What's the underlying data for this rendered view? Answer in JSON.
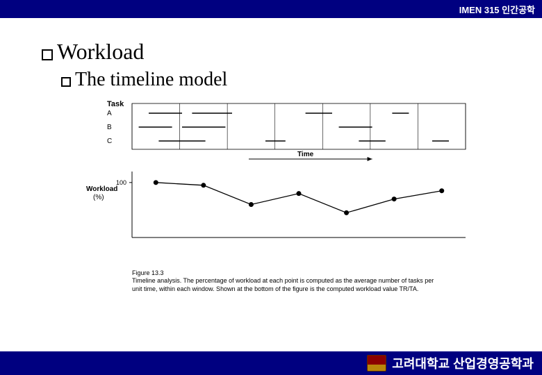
{
  "header": {
    "course": "IMEN 315 인간공학"
  },
  "headings": {
    "h1": "Workload",
    "h2": "The timeline model"
  },
  "figure": {
    "task_label": "Task",
    "tasks": [
      "A",
      "B",
      "C"
    ],
    "time_label": "Time",
    "y_label_line1": "Workload",
    "y_label_line2": "(%)",
    "y_tick": "100"
  },
  "chart_data": {
    "type": "line",
    "title": "Workload (%) over time windows",
    "xlabel": "Time window",
    "ylabel": "Workload (%)",
    "ylim": [
      0,
      120
    ],
    "x": [
      1,
      2,
      3,
      4,
      5,
      6,
      7
    ],
    "values": [
      100,
      95,
      60,
      80,
      45,
      70,
      85
    ],
    "task_segments": {
      "A": [
        [
          0.05,
          0.15
        ],
        [
          0.18,
          0.3
        ],
        [
          0.52,
          0.6
        ],
        [
          0.78,
          0.83
        ]
      ],
      "B": [
        [
          0.02,
          0.12
        ],
        [
          0.15,
          0.28
        ],
        [
          0.62,
          0.72
        ]
      ],
      "C": [
        [
          0.08,
          0.22
        ],
        [
          0.4,
          0.46
        ],
        [
          0.68,
          0.76
        ],
        [
          0.9,
          0.95
        ]
      ]
    }
  },
  "caption": {
    "title": "Figure 13.3",
    "body": "Timeline analysis. The percentage of workload at each point is computed as the average number of tasks per unit time, within each window. Shown at the bottom of the figure is the computed workload value TR/TA."
  },
  "footer": {
    "university": "고려대학교 산업경영공학과"
  }
}
